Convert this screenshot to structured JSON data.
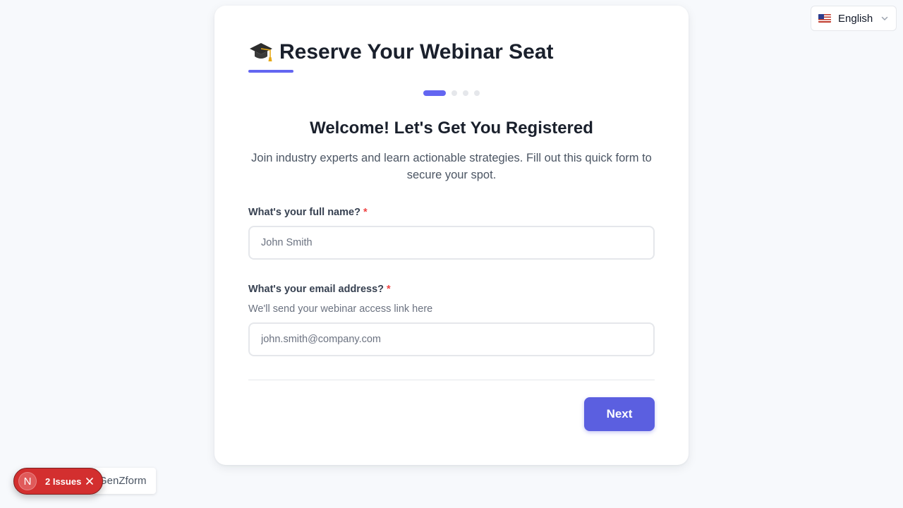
{
  "language_selector": {
    "flag_icon": "us-flag-icon",
    "label": "English",
    "chevron_icon": "chevron-down-icon"
  },
  "form": {
    "title_icon": "graduation-cap-icon",
    "title": "Reserve Your Webinar Seat",
    "progress": {
      "current_step": 1,
      "total_steps": 4
    },
    "heading": "Welcome! Let's Get You Registered",
    "intro": "Join industry experts and learn actionable strategies. Fill out this quick form to secure your spot.",
    "fields": [
      {
        "label": "What's your full name?",
        "required_marker": "*",
        "help": "",
        "value": "",
        "placeholder": "John Smith"
      },
      {
        "label": "What's your email address?",
        "required_marker": "*",
        "help": "We'll send your webinar access link here",
        "value": "",
        "placeholder": "john.smith@company.com"
      }
    ],
    "next_label": "Next"
  },
  "branding": {
    "label": "GenZform"
  },
  "dev_overlay": {
    "badge": "N",
    "issues_label": "2 Issues",
    "close_icon": "close-icon"
  },
  "colors": {
    "accent": "#6366f1",
    "button": "#5b5fe0",
    "required": "#ef4444",
    "issues": "#d32f2f"
  }
}
